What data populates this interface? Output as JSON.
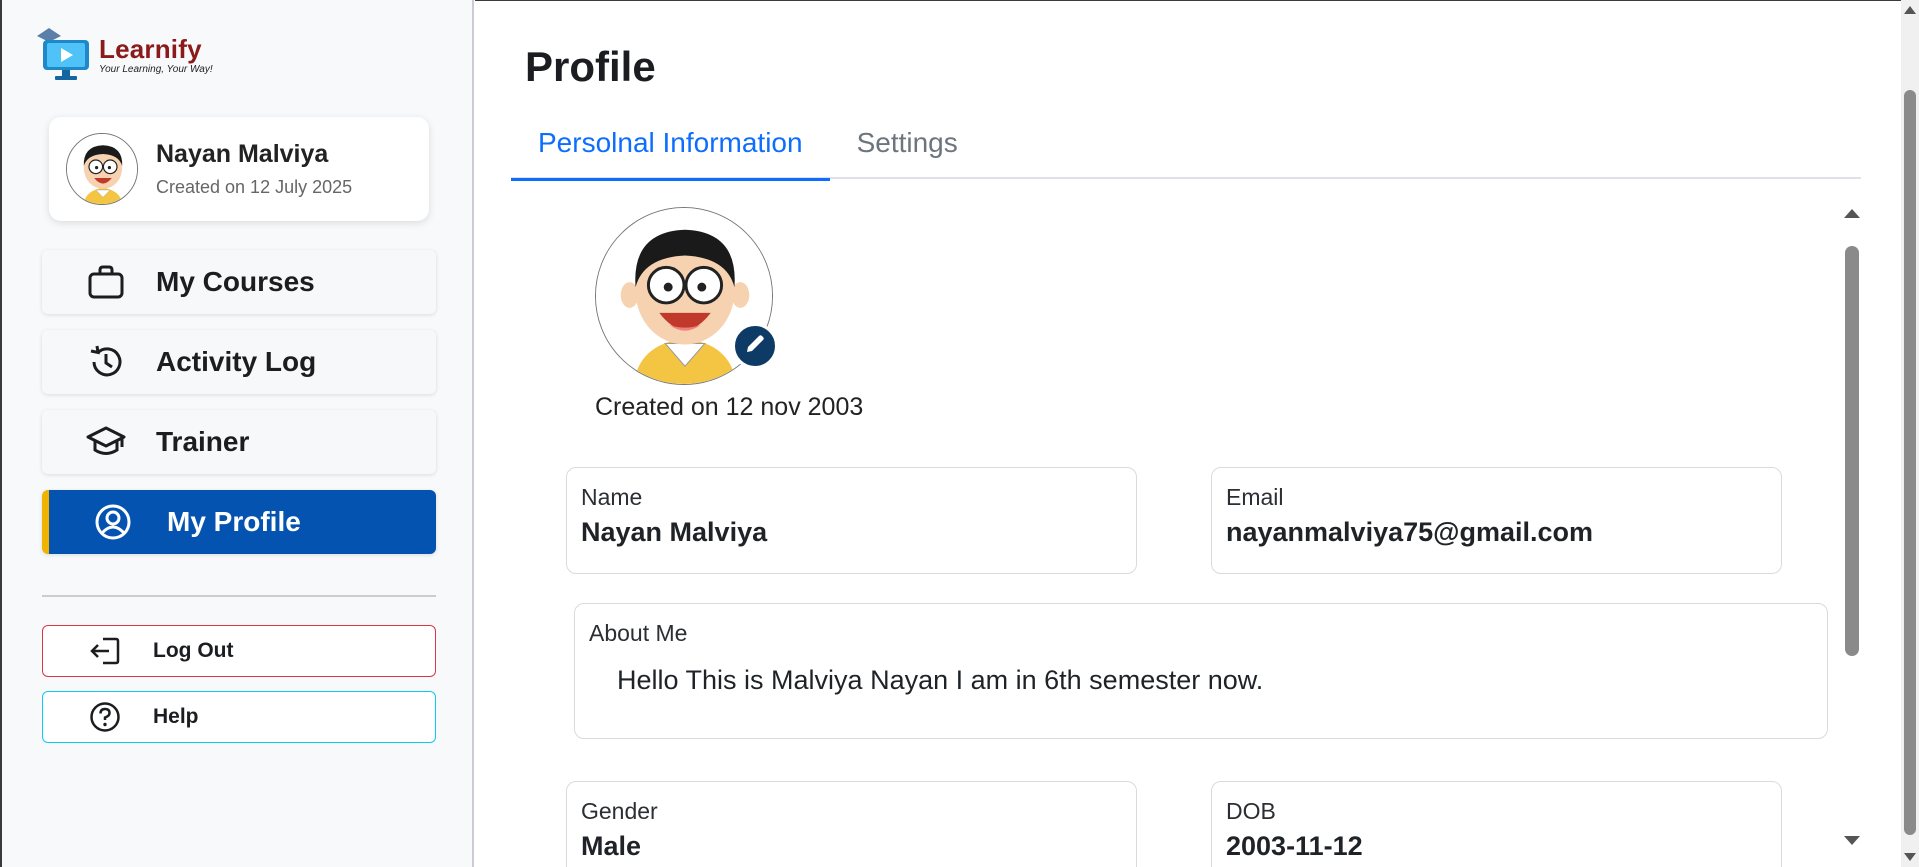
{
  "app": {
    "logo_name": "Learnify",
    "logo_tagline": "Your Learning, Your Way!"
  },
  "sidebar": {
    "user": {
      "name": "Nayan Malviya",
      "created": "Created on 12 July 2025"
    },
    "nav": [
      {
        "label": "My Courses",
        "icon": "briefcase-icon"
      },
      {
        "label": "Activity Log",
        "icon": "history-icon"
      },
      {
        "label": "Trainer",
        "icon": "graduation-cap-icon"
      },
      {
        "label": "My Profile",
        "icon": "user-circle-icon",
        "active": true
      }
    ],
    "logout_label": "Log Out",
    "help_label": "Help"
  },
  "main": {
    "title": "Profile",
    "tabs": [
      {
        "label": "Persolnal Information",
        "active": true
      },
      {
        "label": "Settings",
        "active": false
      }
    ],
    "avatar_created": "Created on 12 nov 2003",
    "fields": {
      "name": {
        "label": "Name",
        "value": "Nayan Malviya"
      },
      "email": {
        "label": "Email",
        "value": "nayanmalviya75@gmail.com"
      },
      "about": {
        "label": "About Me",
        "value": "Hello This is Malviya Nayan I am in 6th semester now."
      },
      "gender": {
        "label": "Gender",
        "value": "Male"
      },
      "dob": {
        "label": "DOB",
        "value": "2003-11-12"
      }
    }
  },
  "colors": {
    "primary": "#0553b1",
    "active_accent": "#f0b400",
    "tab_active": "#0d6efd",
    "logout_border": "#dc3545",
    "help_border": "#0dcaf0",
    "brand": "#8b1a1a"
  }
}
